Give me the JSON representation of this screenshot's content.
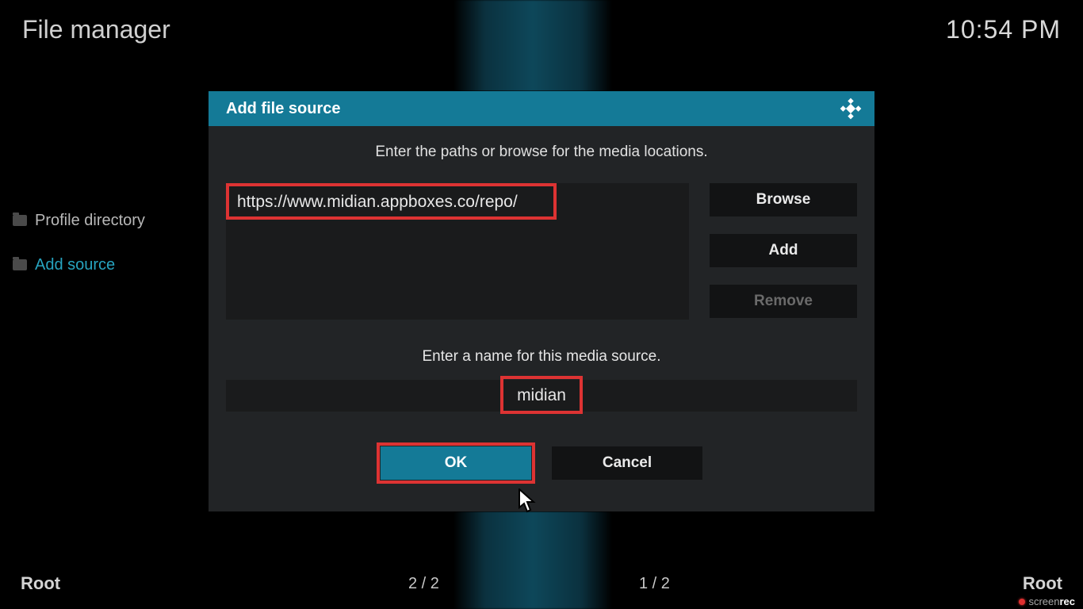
{
  "header": {
    "title": "File manager",
    "clock": "10:54 PM"
  },
  "sidebar": {
    "items": [
      {
        "label": "Profile directory"
      },
      {
        "label": "Add source"
      }
    ]
  },
  "dialog": {
    "title": "Add file source",
    "instr_paths": "Enter the paths or browse for the media locations.",
    "path_value": "https://www.midian.appboxes.co/repo/",
    "browse": "Browse",
    "add": "Add",
    "remove": "Remove",
    "instr_name": "Enter a name for this media source.",
    "name_value": "midian",
    "ok": "OK",
    "cancel": "Cancel"
  },
  "bottom": {
    "root_left": "Root",
    "counter_left": "2 / 2",
    "counter_right": "1 / 2",
    "root_right": "Root"
  },
  "screenrec": {
    "part1": "screen",
    "part2": "rec"
  }
}
